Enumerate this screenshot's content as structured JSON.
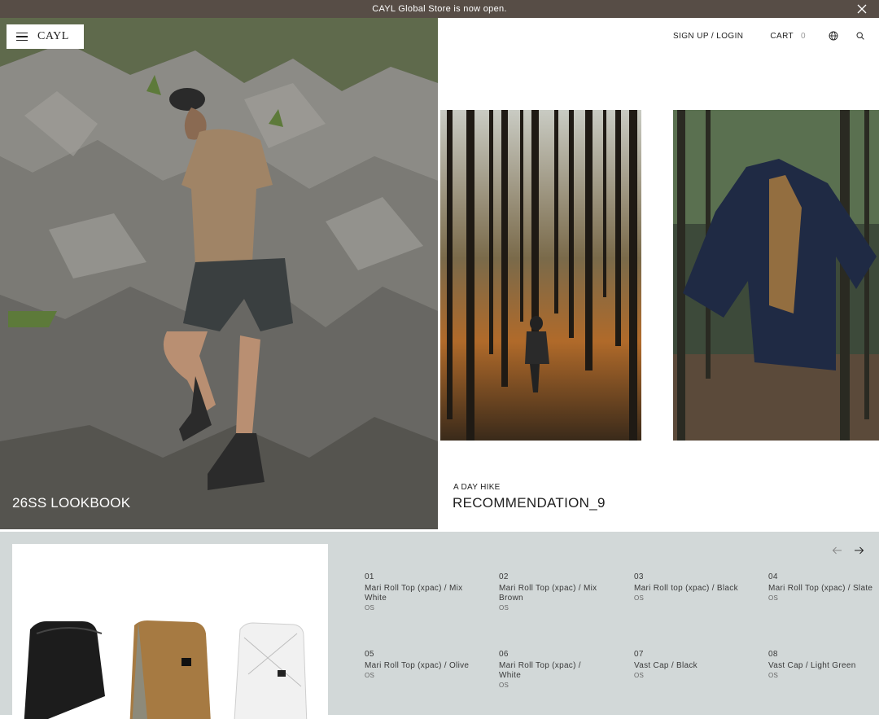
{
  "announcement": {
    "text": "CAYL Global Store is now open."
  },
  "header": {
    "logo": "CAYL",
    "signin_label": "SIGN UP / LOGIN",
    "cart_label": "CART",
    "cart_count": "0"
  },
  "hero": {
    "caption": "26SS LOOKBOOK"
  },
  "recommendation": {
    "subtitle": "A DAY HIKE",
    "title": "RECOMMENDATION_9"
  },
  "products": [
    {
      "num": "01",
      "name": "Mari Roll Top (xpac) / Mix White",
      "size": "OS"
    },
    {
      "num": "02",
      "name": "Mari Roll Top (xpac) / Mix Brown",
      "size": "OS"
    },
    {
      "num": "03",
      "name": "Mari Roll top (xpac) / Black",
      "size": "OS"
    },
    {
      "num": "04",
      "name": "Mari Roll Top (xpac) / Slate",
      "size": "OS"
    },
    {
      "num": "05",
      "name": "Mari Roll Top (xpac) / Olive",
      "size": "OS"
    },
    {
      "num": "06",
      "name": "Mari Roll Top (xpac) / White",
      "size": "OS"
    },
    {
      "num": "07",
      "name": "Vast Cap / Black",
      "size": "OS"
    },
    {
      "num": "08",
      "name": "Vast Cap / Light Green",
      "size": "OS"
    }
  ],
  "icons": {
    "close": "close-icon",
    "menu": "hamburger-icon",
    "globe": "globe-icon",
    "search": "search-icon",
    "prev": "arrow-left-icon",
    "next": "arrow-right-icon"
  },
  "colors": {
    "announcement_bg": "#574d46",
    "product_bg": "#d2d8d8"
  }
}
